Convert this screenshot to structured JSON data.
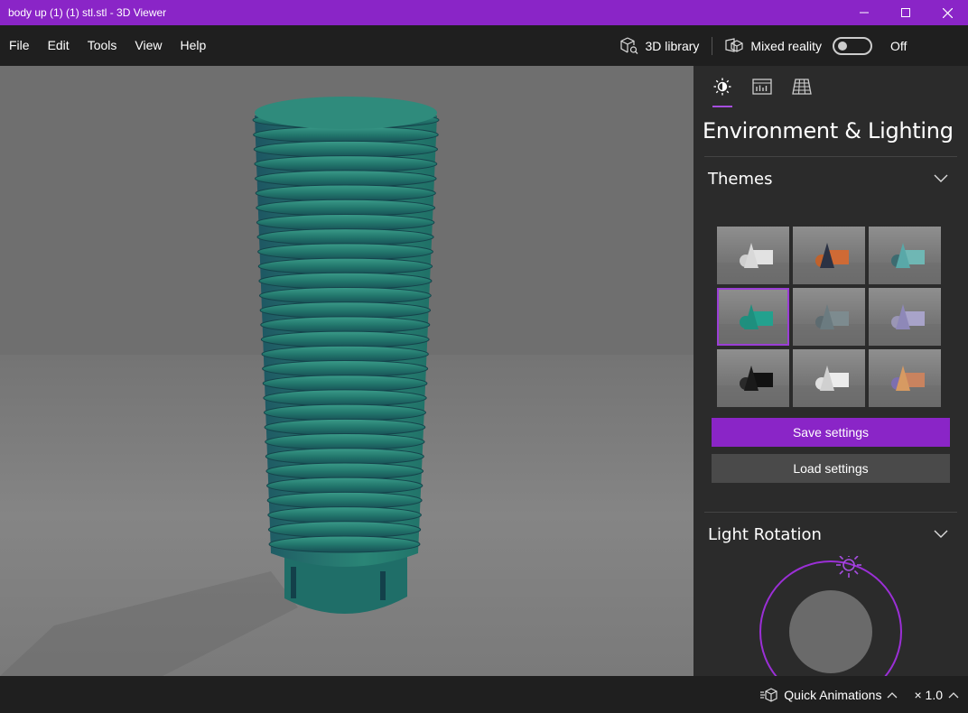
{
  "window": {
    "title": "body up  (1) (1) stl.stl - 3D Viewer",
    "minimize_icon": "minimize-icon",
    "maximize_icon": "maximize-icon",
    "close_icon": "close-icon"
  },
  "menu": {
    "items": [
      "File",
      "Edit",
      "Tools",
      "View",
      "Help"
    ],
    "library_label": "3D library",
    "mixed_reality_label": "Mixed reality",
    "mixed_reality_state": "Off"
  },
  "panel": {
    "tabs": [
      "sun-icon",
      "stats-icon",
      "grid-icon"
    ],
    "title": "Environment & Lighting",
    "themes_label": "Themes",
    "save_label": "Save settings",
    "load_label": "Load settings",
    "light_rotation_label": "Light Rotation",
    "themes": [
      {
        "cone": "#d8d8d8",
        "sphere": "#cfcfcf",
        "box": "#e2e2e2"
      },
      {
        "cone": "#2b3244",
        "sphere": "#c0622c",
        "box": "#cf6a35"
      },
      {
        "cone": "#59a8a8",
        "sphere": "#3d6b70",
        "box": "#6fb7b4"
      },
      {
        "cone": "#1e8f7e",
        "sphere": "#1f8f7e",
        "box": "#23a18e"
      },
      {
        "cone": "#6b7b80",
        "sphere": "#5d6b70",
        "box": "#7d8b8f"
      },
      {
        "cone": "#8e88b8",
        "sphere": "#9a96b5",
        "box": "#a8a3c9"
      },
      {
        "cone": "#1a1a1a",
        "sphere": "#2a2a2a",
        "box": "#111111"
      },
      {
        "cone": "#d0d0d0",
        "sphere": "#e0e0e0",
        "box": "#ececec"
      },
      {
        "cone": "#d79a62",
        "sphere": "#7c6fb0",
        "box": "#c9835f"
      }
    ],
    "selected_theme": 3
  },
  "status": {
    "quick_animations_label": "Quick Animations",
    "speed_label": "× 1.0"
  },
  "colors": {
    "accent": "#8a25c7",
    "model": "#1f7d73"
  }
}
